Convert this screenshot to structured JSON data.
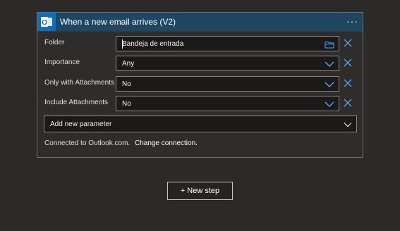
{
  "trigger": {
    "title": "When a new email arrives (V2)",
    "menu_label": "···",
    "icon": "outlook-icon",
    "accent_color": "#1f4761",
    "icon_color": "#0f6cbd"
  },
  "fields": [
    {
      "label": "Folder",
      "value": "Bandeja de entrada",
      "control": "folder-picker",
      "icon": "folder-icon"
    },
    {
      "label": "Importance",
      "value": "Any",
      "control": "dropdown",
      "icon": "chevron-down-icon"
    },
    {
      "label": "Only with Attachments",
      "value": "No",
      "control": "dropdown",
      "icon": "chevron-down-icon"
    },
    {
      "label": "Include Attachments",
      "value": "No",
      "control": "dropdown",
      "icon": "chevron-down-icon"
    }
  ],
  "add_parameter": {
    "label": "Add new parameter",
    "icon": "chevron-down-icon"
  },
  "connection": {
    "text": "Connected to Outlook.com.",
    "link": "Change connection."
  },
  "new_step": {
    "label": "+ New step"
  },
  "colors": {
    "link_accent": "#4fa3e8",
    "background": "#2b2a29"
  }
}
